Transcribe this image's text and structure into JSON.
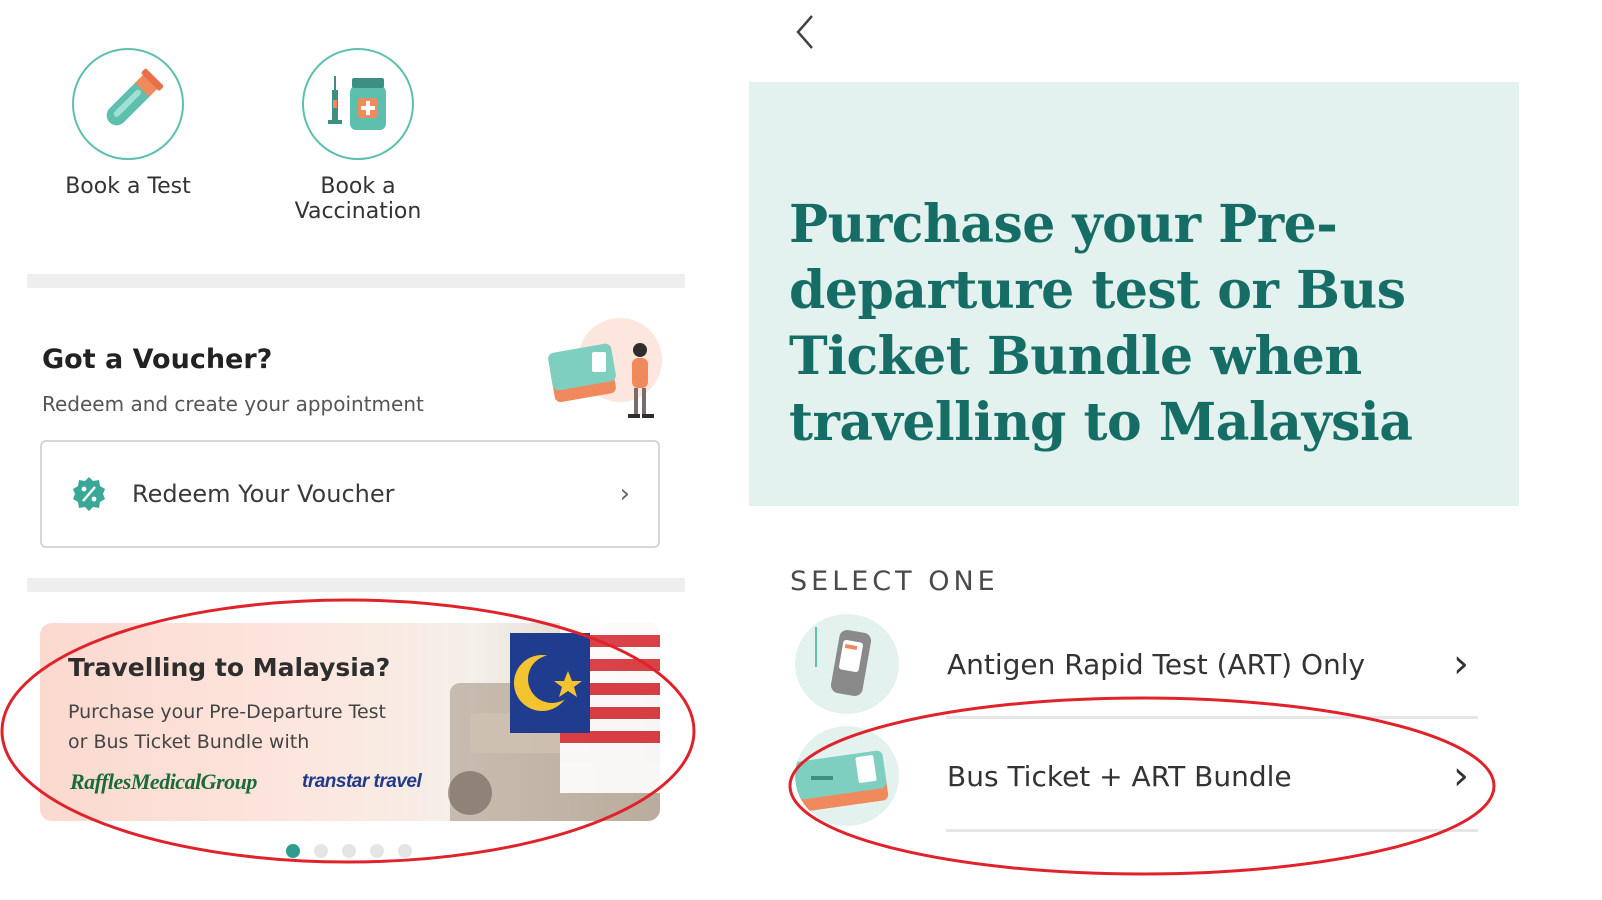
{
  "left": {
    "quick_actions": [
      {
        "label": "Book a Test",
        "icon": "test-tube-icon"
      },
      {
        "label": "Book a Vaccination",
        "icon": "vaccine-icon"
      }
    ],
    "voucher": {
      "title": "Got a Voucher?",
      "subtitle": "Redeem and create your appointment",
      "button_label": "Redeem Your Voucher"
    },
    "banner": {
      "title": "Travelling to Malaysia?",
      "line1": "Purchase your Pre-Departure Test",
      "line2": "or Bus Ticket Bundle with",
      "logo1": "RafflesMedicalGroup",
      "logo2": "transtar travel"
    },
    "carousel": {
      "count": 5,
      "active": 0
    }
  },
  "right": {
    "hero_title": "Purchase your Pre-departure test or Bus Ticket Bundle when travelling to Malaysia",
    "section_label": "SELECT ONE",
    "options": [
      {
        "label": "Antigen Rapid Test (ART) Only",
        "icon": "antigen-test-kit-icon"
      },
      {
        "label": "Bus Ticket + ART Bundle",
        "icon": "bus-ticket-icon"
      }
    ]
  },
  "colors": {
    "teal": "#166d66",
    "accent": "#5fbfae",
    "hero_bg": "#e3f2ef",
    "annotation": "#e0232b"
  }
}
